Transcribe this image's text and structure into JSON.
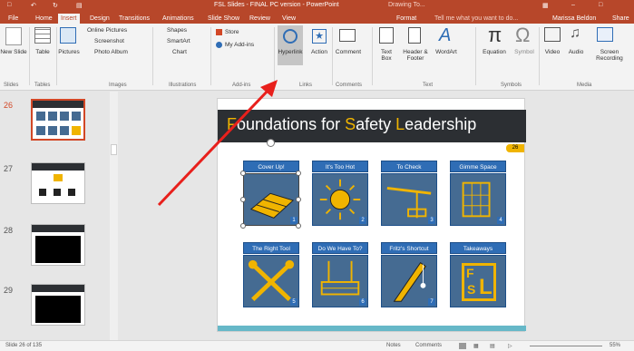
{
  "titlebar": {
    "title": "FSL Slides - FINAL PC version - PowerPoint",
    "context": "Drawing To...",
    "user": "Marissa Beldon",
    "share": "Share"
  },
  "tabs": [
    {
      "label": "File"
    },
    {
      "label": "Home"
    },
    {
      "label": "Insert"
    },
    {
      "label": "Design"
    },
    {
      "label": "Transitions"
    },
    {
      "label": "Animations"
    },
    {
      "label": "Slide Show"
    },
    {
      "label": "Review"
    },
    {
      "label": "View"
    },
    {
      "label": "Format"
    },
    {
      "label": "Tell me what you want to do..."
    }
  ],
  "ribbon": {
    "new_slide": "New Slide",
    "table": "Table",
    "pictures": "Pictures",
    "online_pictures": "Online Pictures",
    "screenshot": "Screenshot",
    "photo_album": "Photo Album",
    "shapes": "Shapes",
    "smartart": "SmartArt",
    "chart": "Chart",
    "store": "Store",
    "my_addins": "My Add-ins",
    "hyperlink": "Hyperlink",
    "action": "Action",
    "comment": "Comment",
    "text_box": "Text Box",
    "header_footer": "Header & Footer",
    "wordart": "WordArt",
    "equation": "Equation",
    "symbol": "Symbol",
    "video": "Video",
    "audio": "Audio",
    "screen_recording": "Screen Recording",
    "groups": {
      "slides": "Slides",
      "tables": "Tables",
      "images": "Images",
      "illustrations": "Illustrations",
      "addins": "Add-ins",
      "links": "Links",
      "comments": "Comments",
      "text": "Text",
      "symbols": "Symbols",
      "media": "Media"
    }
  },
  "thumbnails": [
    {
      "num": "26"
    },
    {
      "num": "27"
    },
    {
      "num": "28"
    },
    {
      "num": "29"
    }
  ],
  "slide": {
    "title_f": "F",
    "title_1": "oundations for ",
    "title_s": "S",
    "title_2": "afety ",
    "title_l": "L",
    "title_3": "eadership",
    "page_badge": "26",
    "tiles": [
      {
        "label": "Cover Up!",
        "num": "1"
      },
      {
        "label": "It's Too Hot",
        "num": "2"
      },
      {
        "label": "To Check",
        "num": "3"
      },
      {
        "label": "Gimme Space",
        "num": "4"
      },
      {
        "label": "The Right Tool",
        "num": "5"
      },
      {
        "label": "Do We Have To?",
        "num": "6"
      },
      {
        "label": "Fritz's Shortcut",
        "num": "7"
      },
      {
        "label": "Takeaways",
        "num": ""
      }
    ],
    "fsl_f": "F",
    "fsl_s": "S",
    "fsl_l": "L"
  },
  "status": {
    "slide_count": "Slide 26 of 135",
    "notes": "Notes",
    "comments": "Comments",
    "zoom": "55%"
  },
  "colors": {
    "accent": "#b7472a",
    "tile_blue": "#2f6db5",
    "gold": "#f0b400",
    "arrow": "#e8201c"
  }
}
